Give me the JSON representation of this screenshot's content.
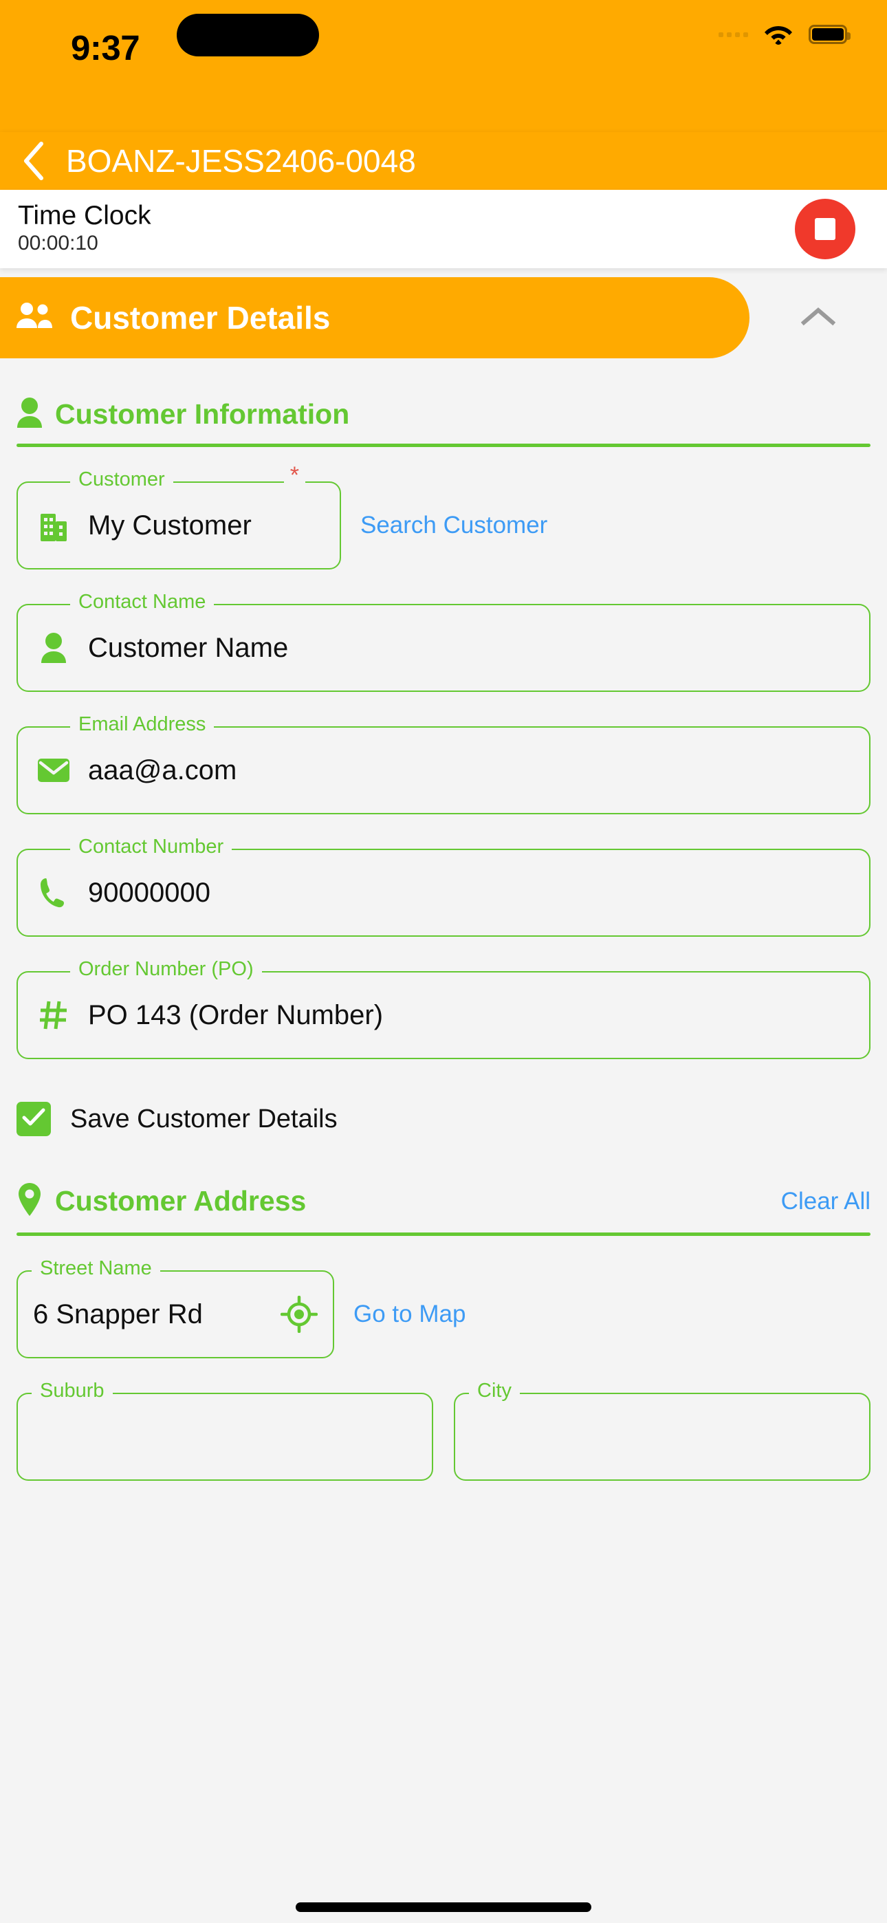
{
  "status_bar": {
    "time": "9:37",
    "icons": [
      "signal-dots-icon",
      "wifi-icon",
      "battery-icon"
    ]
  },
  "nav": {
    "back_icon": "chevron-left-icon",
    "title": "BOANZ-JESS2406-0048"
  },
  "time_clock": {
    "title": "Time Clock",
    "elapsed": "00:00:10",
    "stop_button_icon": "stop-square-icon"
  },
  "section": {
    "icon": "people-icon",
    "title": "Customer Details",
    "collapse_icon": "chevron-up-icon",
    "expanded": true
  },
  "customer_information": {
    "icon": "person-icon",
    "heading": "Customer Information",
    "fields": [
      {
        "label": "Customer",
        "value": "My Customer",
        "icon": "building-icon",
        "required": true,
        "required_mark": "*",
        "link": "Search Customer"
      },
      {
        "label": "Contact Name",
        "value": "Customer Name",
        "icon": "person-icon",
        "required": false
      },
      {
        "label": "Email Address",
        "value": "aaa@a.com",
        "icon": "envelope-icon",
        "required": false
      },
      {
        "label": "Contact Number",
        "value": "90000000",
        "icon": "phone-icon",
        "required": false
      },
      {
        "label": "Order Number (PO)",
        "value": "PO 143 (Order Number)",
        "icon": "hash-icon",
        "required": false
      }
    ],
    "save_checkbox": {
      "label": "Save Customer Details",
      "checked": true,
      "icon": "checkmark-icon"
    }
  },
  "customer_address": {
    "icon": "map-pin-icon",
    "heading": "Customer Address",
    "clear_all": "Clear All",
    "street": {
      "label": "Street Name",
      "value": "6 Snapper Rd",
      "locate_icon": "crosshair-location-icon",
      "link": "Go to Map"
    },
    "suburb": {
      "label": "Suburb",
      "value": ""
    },
    "city": {
      "label": "City",
      "value": ""
    }
  },
  "colors": {
    "orange": "#FFAA00",
    "green": "#64C832",
    "blue_link": "#3D9BF5",
    "red_stop": "#F0392B",
    "red_asterisk": "#E2574C",
    "page_bg": "#F4F4F4"
  }
}
